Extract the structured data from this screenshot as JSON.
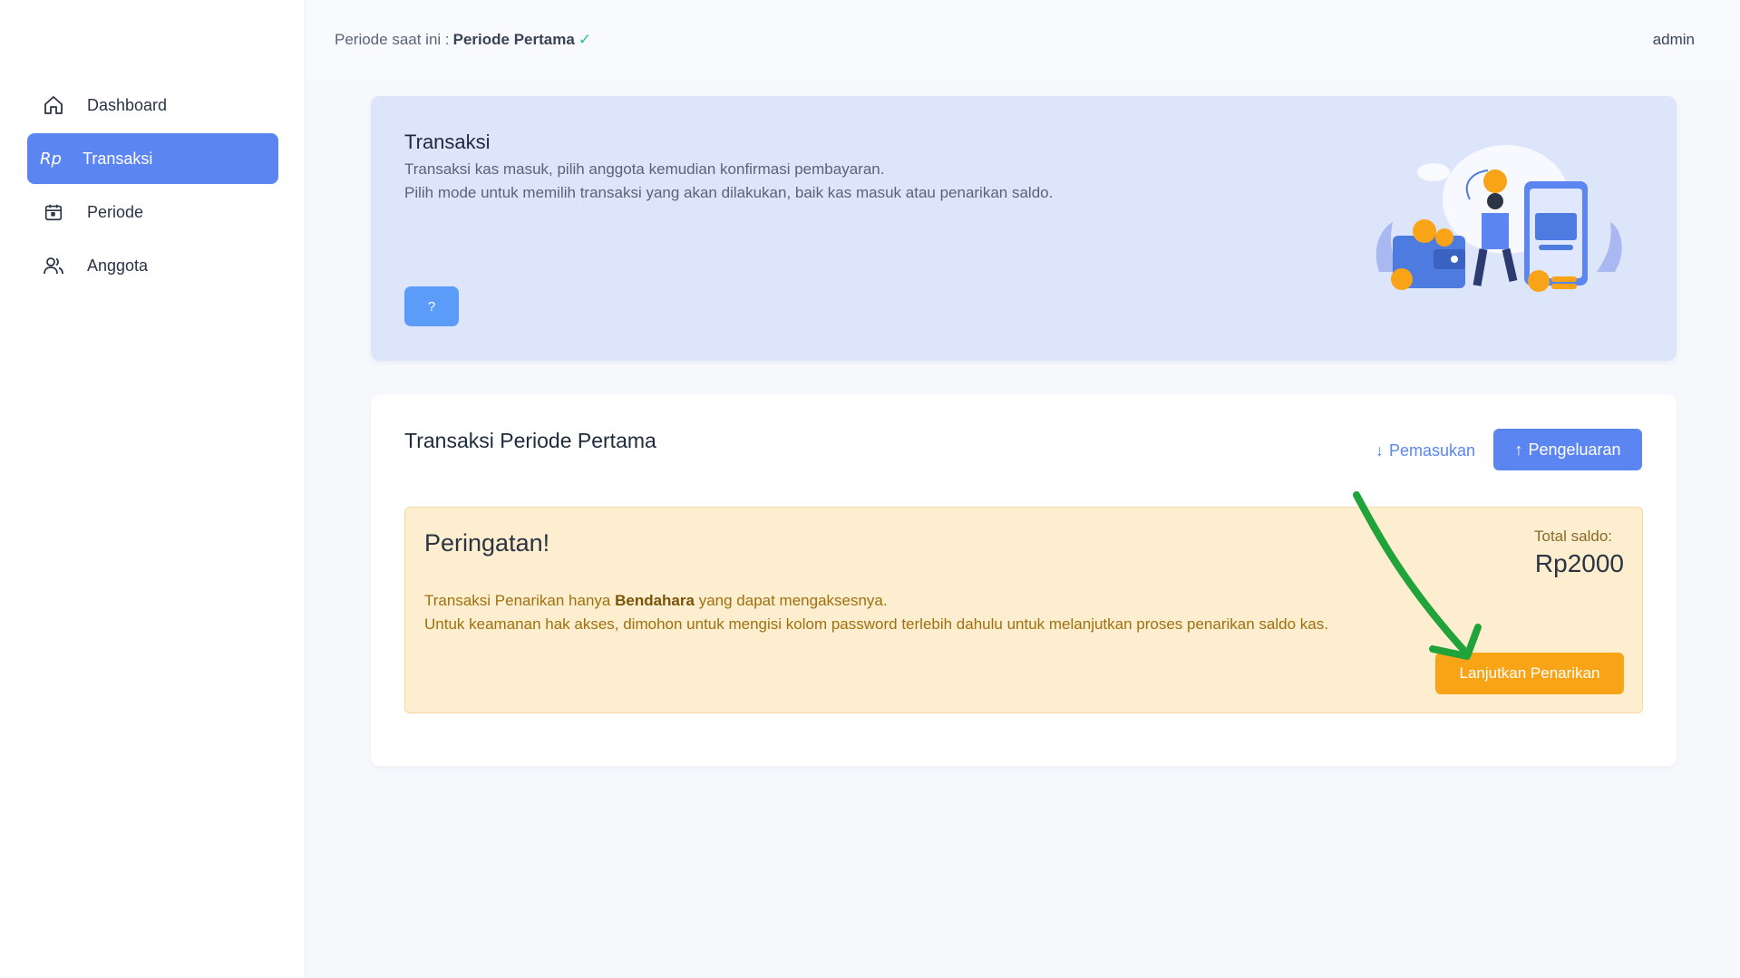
{
  "sidebar": {
    "items": [
      {
        "label": "Dashboard",
        "icon": "home-icon",
        "active": false
      },
      {
        "label": "Transaksi",
        "icon": "rupiah-icon",
        "icon_text": "Rp",
        "active": true
      },
      {
        "label": "Periode",
        "icon": "calendar-icon",
        "active": false
      },
      {
        "label": "Anggota",
        "icon": "users-icon",
        "active": false
      }
    ]
  },
  "topbar": {
    "period_prefix": "Periode saat ini :",
    "period_name": "Periode Pertama",
    "check_icon": "✓",
    "user": "admin"
  },
  "banner": {
    "title": "Transaksi",
    "line1": "Transaksi kas masuk, pilih anggota kemudian konfirmasi pembayaran.",
    "line2": "Pilih mode untuk memilih transaksi yang akan dilakukan, baik kas masuk atau penarikan saldo.",
    "help_label": "?"
  },
  "card": {
    "title": "Transaksi Periode Pertama",
    "tab_in_label": "Pemasukan",
    "tab_out_label": "Pengeluaran",
    "warning": {
      "heading": "Peringatan!",
      "line1_pre": "Transaksi Penarikan hanya ",
      "line1_bold": "Bendahara",
      "line1_post": " yang dapat mengaksesnya.",
      "line2": "Untuk keamanan hak akses, dimohon untuk mengisi kolom password terlebih dahulu untuk melanjutkan proses penarikan saldo kas.",
      "total_label": "Total saldo:",
      "total_value": "Rp2000",
      "proceed_label": "Lanjutkan Penarikan"
    }
  },
  "colors": {
    "primary": "#5b86f2",
    "warning_bg": "#fdeecf",
    "warning_btn": "#f8a416",
    "banner_bg": "#dde5fb",
    "annotation_arrow": "#1fa33a"
  }
}
